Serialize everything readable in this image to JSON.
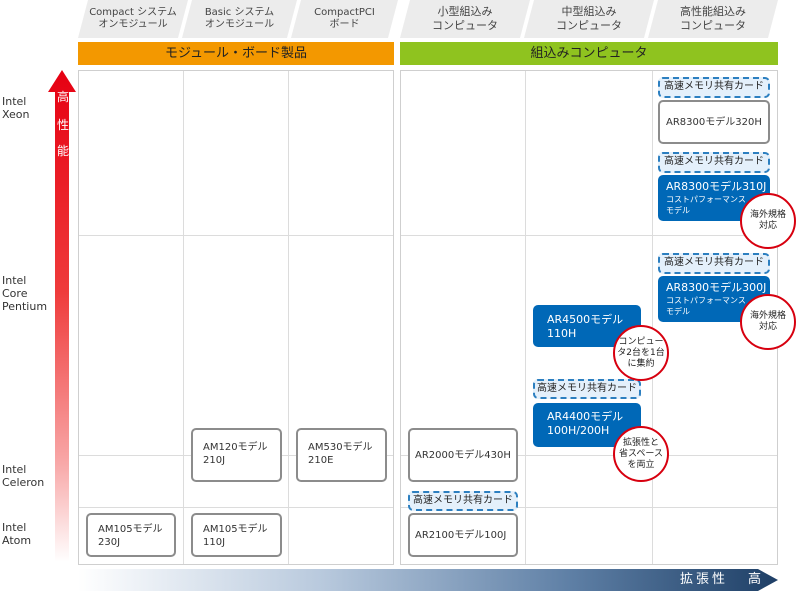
{
  "header": {
    "columns": [
      {
        "line1": "Compact システム",
        "line2": "オンモジュール"
      },
      {
        "line1": "Basic システム",
        "line2": "オンモジュール"
      },
      {
        "line1": "CompactPCI",
        "line2": "ボード"
      },
      {
        "line1": "小型組込み",
        "line2": "コンピュータ"
      },
      {
        "line1": "中型組込み",
        "line2": "コンピュータ"
      },
      {
        "line1": "高性能組込み",
        "line2": "コンピュータ"
      }
    ],
    "group_module": "モジュール・ボード製品",
    "group_embedded": "組込みコンピュータ"
  },
  "y_axis": {
    "perf_chars": [
      "高",
      "性",
      "能"
    ],
    "levels": [
      {
        "lines": [
          "Intel",
          "Xeon"
        ]
      },
      {
        "lines": [
          "Intel",
          "Core",
          "Pentium"
        ]
      },
      {
        "lines": [
          "Intel",
          "Celeron"
        ]
      },
      {
        "lines": [
          "Intel",
          "Atom"
        ]
      }
    ]
  },
  "x_axis": {
    "label": "拡張性",
    "high": "高"
  },
  "memory_card_label": "高速メモリ共有カード",
  "products": {
    "am105_230j": [
      "AM105モデル",
      "230J"
    ],
    "am105_110j": [
      "AM105モデル",
      "110J"
    ],
    "am120_210j": [
      "AM120モデル",
      "210J"
    ],
    "am530_210e": [
      "AM530モデル",
      "210E"
    ],
    "ar2000": "AR2000モデル430H",
    "ar2100": "AR2100モデル100J",
    "ar4500": [
      "AR4500モデル",
      "110H"
    ],
    "ar4400": [
      "AR4400モデル",
      "100H/200H"
    ],
    "ar8300_320h": "AR8300モデル320H",
    "ar8300_310j": {
      "name": "AR8300モデル310J",
      "sub1": "コストパフォーマンス",
      "sub2": "モデル"
    },
    "ar8300_300j": {
      "name": "AR8300モデル300J",
      "sub1": "コストパフォーマンス",
      "sub2": "モデル"
    }
  },
  "badges": {
    "overseas_1": [
      "海外規格",
      "対応"
    ],
    "overseas_2": [
      "海外規格",
      "対応"
    ],
    "consolidate": [
      "コンピュー",
      "タ2台を1台",
      "に集約"
    ],
    "expand": [
      "拡張性と",
      "省スペース",
      "を両立"
    ]
  },
  "colors": {
    "module_band": "#f39800",
    "embedded_band": "#8fc31f",
    "product_blue": "#0068b7",
    "badge_red": "#d7000f",
    "memory_border": "#2c7fc0"
  }
}
